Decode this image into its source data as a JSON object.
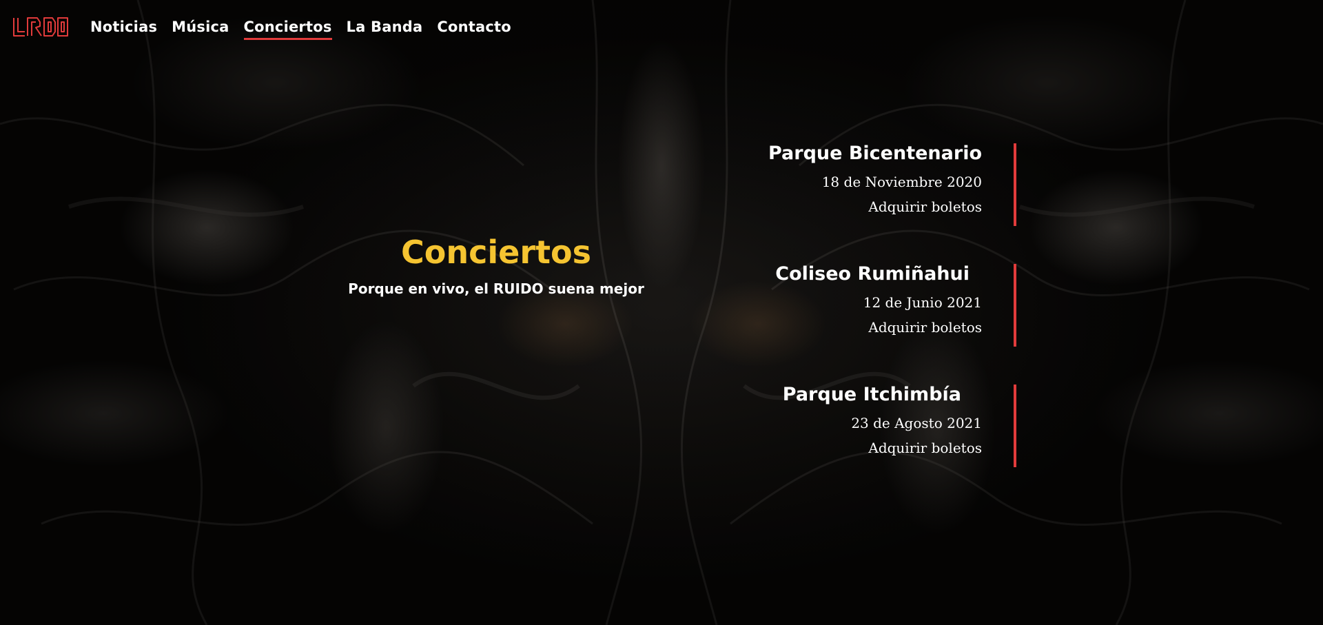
{
  "site": {
    "logo_text": "LRDO",
    "logo_color": "#e23b3b"
  },
  "nav": {
    "items": [
      {
        "label": "Noticias",
        "active": false
      },
      {
        "label": "Música",
        "active": false
      },
      {
        "label": "Conciertos",
        "active": true
      },
      {
        "label": "La Banda",
        "active": false
      },
      {
        "label": "Contacto",
        "active": false
      }
    ]
  },
  "hero": {
    "title": "Conciertos",
    "subtitle": "Porque en vivo, el RUIDO suena mejor"
  },
  "concerts": [
    {
      "venue": "Parque Bicentenario",
      "date": "18 de Noviembre 2020",
      "cta": "Adquirir boletos"
    },
    {
      "venue": "Coliseo Rumiñahui",
      "date": "12 de Junio 2021",
      "cta": "Adquirir boletos"
    },
    {
      "venue": "Parque Itchimbía",
      "date": "23 de Agosto 2021",
      "cta": "Adquirir boletos"
    }
  ],
  "colors": {
    "accent_red": "#e23b3b",
    "title_yellow": "#f5c431",
    "text": "#ffffff"
  }
}
